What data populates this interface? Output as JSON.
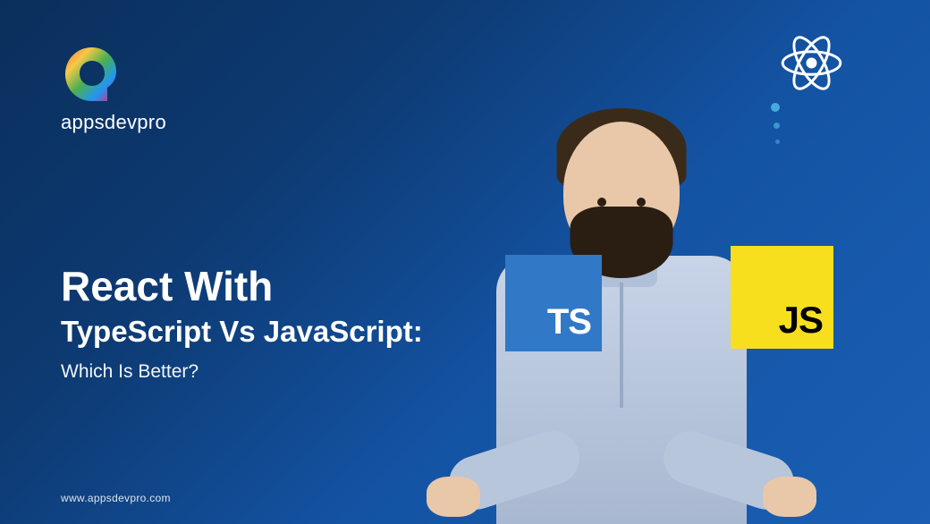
{
  "brand": {
    "name": "appsdevpro",
    "url": "www.appsdevpro.com"
  },
  "headline": {
    "line1": "React With",
    "line2": "TypeScript Vs JavaScript:",
    "line3": "Which Is Better?"
  },
  "badges": {
    "typescript": {
      "label": "TS",
      "color": "#3178c6"
    },
    "javascript": {
      "label": "JS",
      "color": "#f7df1e"
    }
  },
  "icons": {
    "react": "react-logo"
  }
}
